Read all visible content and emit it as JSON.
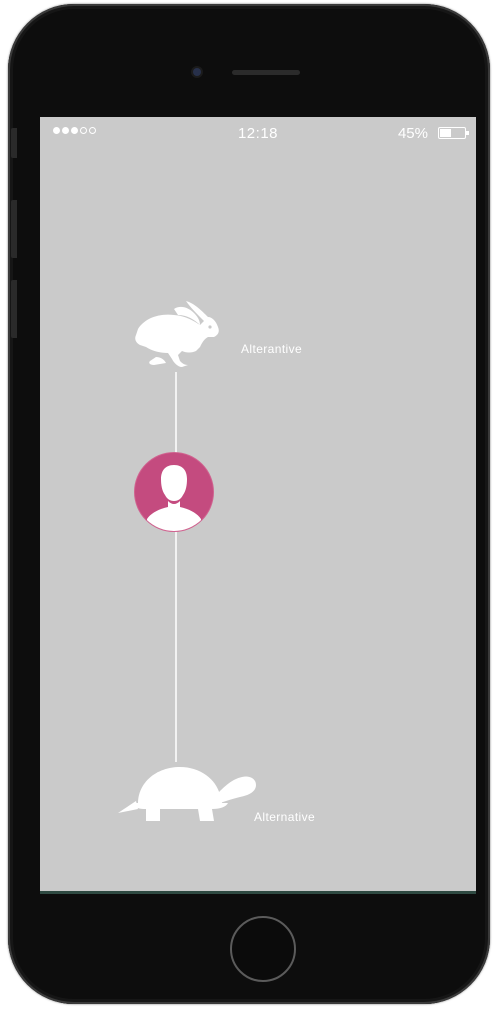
{
  "status_bar": {
    "signal_dots": [
      true,
      true,
      true,
      false,
      false
    ],
    "time": "12:18",
    "battery_percent": "45%",
    "battery_level": 0.45
  },
  "timeline": {
    "top_option": {
      "label": "Alterantive",
      "icon": "rabbit-icon"
    },
    "current_user": {
      "icon": "user-avatar-icon",
      "color": "#c44b7f"
    },
    "bottom_option": {
      "label": "Alternative",
      "icon": "turtle-icon"
    }
  },
  "colors": {
    "screen_background": "#cacaca",
    "foreground": "#ffffff",
    "accent": "#c44b7f"
  }
}
